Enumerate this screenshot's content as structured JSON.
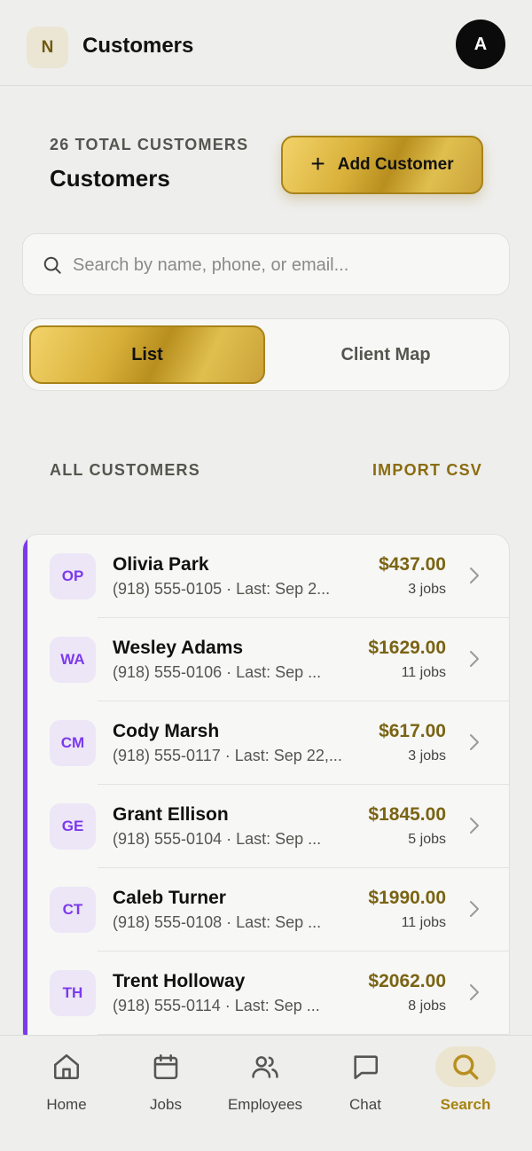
{
  "header": {
    "logo_letter": "N",
    "title": "Customers",
    "avatar_letter": "A"
  },
  "summary": {
    "count_label": "26 TOTAL CUSTOMERS",
    "title": "Customers",
    "add_button_label": "Add Customer"
  },
  "search": {
    "placeholder": "Search by name, phone, or email...",
    "value": ""
  },
  "view_toggle": {
    "list_label": "List",
    "map_label": "Client Map",
    "selected": "List"
  },
  "section": {
    "label": "ALL CUSTOMERS",
    "import_label": "IMPORT CSV"
  },
  "customers": [
    {
      "initials": "OP",
      "name": "Olivia Park",
      "details": "(918) 555-0105 · Last: Sep 2...",
      "amount": "$437.00",
      "jobs": "3 jobs"
    },
    {
      "initials": "WA",
      "name": "Wesley Adams",
      "details": "(918) 555-0106 · Last: Sep ...",
      "amount": "$1629.00",
      "jobs": "11 jobs"
    },
    {
      "initials": "CM",
      "name": "Cody Marsh",
      "details": "(918) 555-0117 · Last: Sep 22,...",
      "amount": "$617.00",
      "jobs": "3 jobs"
    },
    {
      "initials": "GE",
      "name": "Grant Ellison",
      "details": "(918) 555-0104 · Last: Sep ...",
      "amount": "$1845.00",
      "jobs": "5 jobs"
    },
    {
      "initials": "CT",
      "name": "Caleb Turner",
      "details": "(918) 555-0108 · Last: Sep ...",
      "amount": "$1990.00",
      "jobs": "11 jobs"
    },
    {
      "initials": "TH",
      "name": "Trent Holloway",
      "details": "(918) 555-0114 · Last: Sep ...",
      "amount": "$2062.00",
      "jobs": "8 jobs"
    }
  ],
  "nav": {
    "items": [
      {
        "label": "Home",
        "icon": "home-icon"
      },
      {
        "label": "Jobs",
        "icon": "calendar-icon"
      },
      {
        "label": "Employees",
        "icon": "users-icon"
      },
      {
        "label": "Chat",
        "icon": "chat-icon"
      },
      {
        "label": "Search",
        "icon": "search-icon"
      }
    ],
    "active": "Search"
  },
  "colors": {
    "accent_gold": "#b88f1f",
    "customer_accent": "#7c3aed",
    "amount_text": "#7a6414"
  }
}
